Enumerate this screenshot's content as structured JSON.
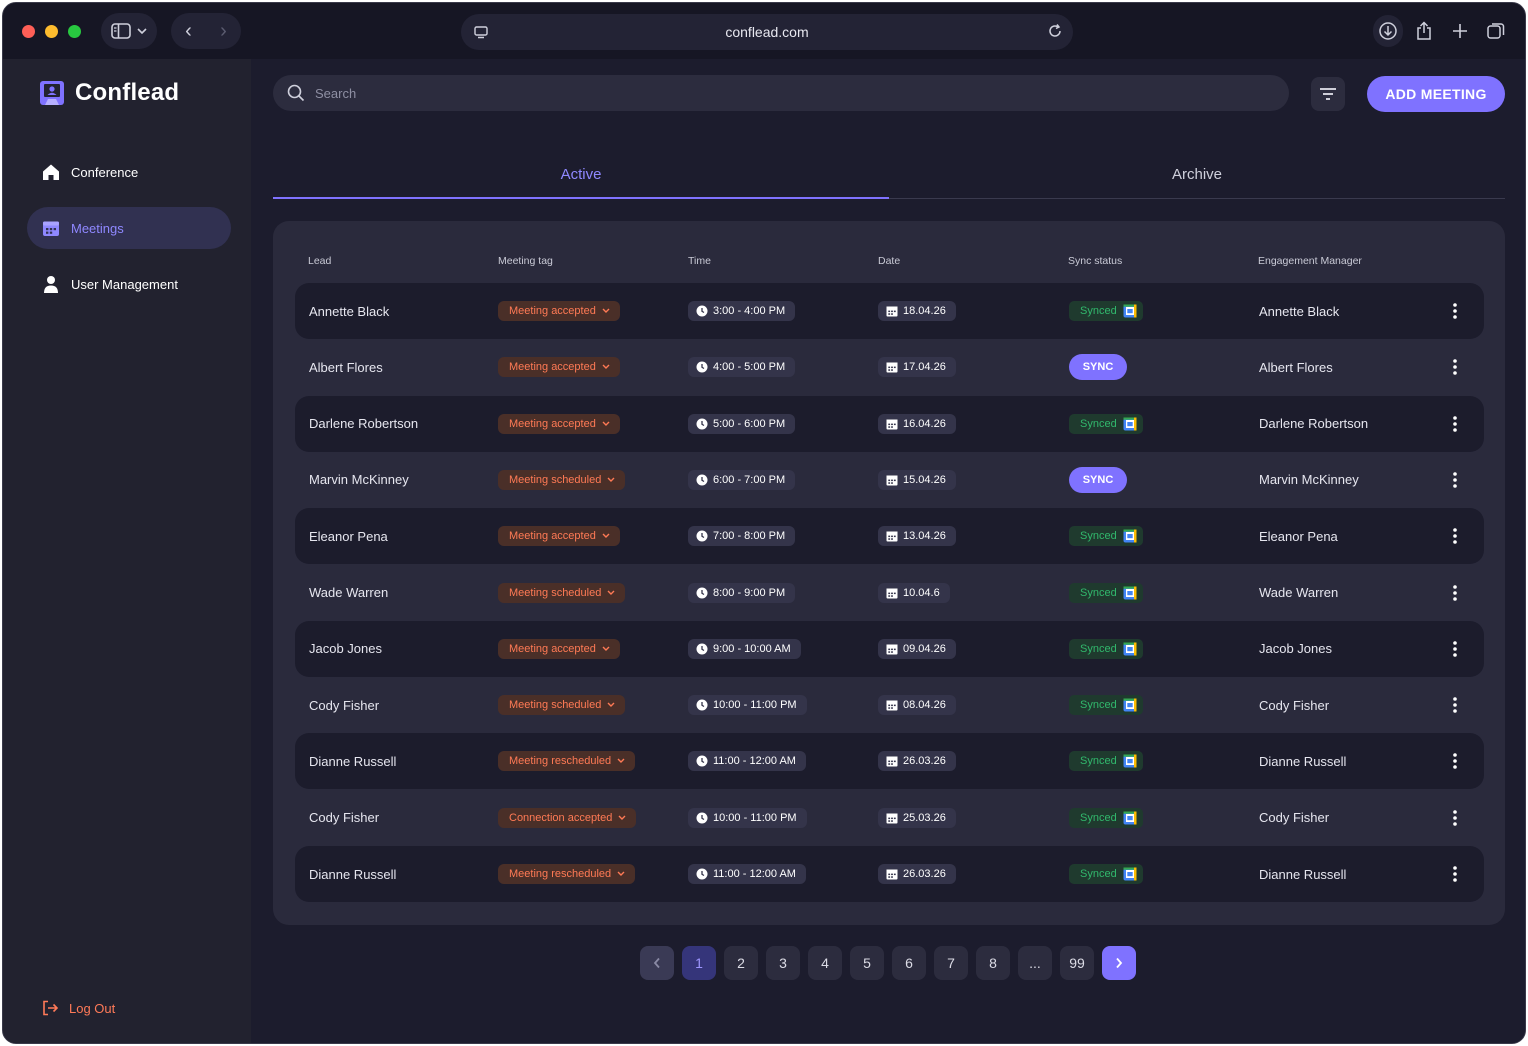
{
  "browser": {
    "url": "conflead.com"
  },
  "app": {
    "name": "Conflead"
  },
  "sidebar": {
    "items": [
      {
        "label": "Conference"
      },
      {
        "label": "Meetings"
      },
      {
        "label": "User Management"
      }
    ],
    "logout": "Log Out"
  },
  "toolbar": {
    "search_placeholder": "Search",
    "add_label": "ADD MEETING"
  },
  "tabs": [
    {
      "label": "Active"
    },
    {
      "label": "Archive"
    }
  ],
  "table": {
    "headers": [
      "Lead",
      "Meeting tag",
      "Time",
      "Date",
      "Sync status",
      "Engagement Manager"
    ],
    "rows": [
      {
        "lead": "Annette Black",
        "tag": "Meeting accepted",
        "time": "3:00 - 4:00 PM",
        "date": "18.04.26",
        "sync": "Synced",
        "em": "Annette Black"
      },
      {
        "lead": "Albert Flores",
        "tag": "Meeting accepted",
        "time": "4:00 - 5:00 PM",
        "date": "17.04.26",
        "sync": "SYNC",
        "em": "Albert Flores"
      },
      {
        "lead": "Darlene Robertson",
        "tag": "Meeting accepted",
        "time": "5:00 - 6:00 PM",
        "date": "16.04.26",
        "sync": "Synced",
        "em": "Darlene Robertson"
      },
      {
        "lead": "Marvin McKinney",
        "tag": "Meeting scheduled",
        "time": "6:00 - 7:00 PM",
        "date": "15.04.26",
        "sync": "SYNC",
        "em": "Marvin McKinney"
      },
      {
        "lead": "Eleanor Pena",
        "tag": "Meeting accepted",
        "time": "7:00 - 8:00 PM",
        "date": "13.04.26",
        "sync": "Synced",
        "em": "Eleanor Pena"
      },
      {
        "lead": "Wade Warren",
        "tag": "Meeting scheduled",
        "time": "8:00 - 9:00 PM",
        "date": "10.04.6",
        "sync": "Synced",
        "em": "Wade Warren"
      },
      {
        "lead": "Jacob Jones",
        "tag": "Meeting accepted",
        "time": "9:00 - 10:00 AM",
        "date": "09.04.26",
        "sync": "Synced",
        "em": "Jacob Jones"
      },
      {
        "lead": "Cody Fisher",
        "tag": "Meeting scheduled",
        "time": "10:00 - 11:00 PM",
        "date": "08.04.26",
        "sync": "Synced",
        "em": "Cody Fisher"
      },
      {
        "lead": "Dianne Russell",
        "tag": "Meeting rescheduled",
        "time": "11:00 - 12:00 AM",
        "date": "26.03.26",
        "sync": "Synced",
        "em": "Dianne Russell"
      },
      {
        "lead": "Cody Fisher",
        "tag": "Connection accepted",
        "time": "10:00 - 11:00 PM",
        "date": "25.03.26",
        "sync": "Synced",
        "em": "Cody Fisher"
      },
      {
        "lead": "Dianne Russell",
        "tag": "Meeting rescheduled",
        "time": "11:00 - 12:00 AM",
        "date": "26.03.26",
        "sync": "Synced",
        "em": "Dianne Russell"
      }
    ]
  },
  "pagination": {
    "pages": [
      "1",
      "2",
      "3",
      "4",
      "5",
      "6",
      "7",
      "8",
      "...",
      "99"
    ],
    "current": "1"
  },
  "colors": {
    "accent": "#7f72ff",
    "tag_text": "#ff7a55",
    "synced_text": "#31b86c",
    "background": "#1c1c2d"
  },
  "icons": {
    "nav": [
      "home-icon",
      "calendar-icon",
      "user-icon"
    ],
    "row": [
      "clock-icon",
      "calendar-icon",
      "google-calendar-icon",
      "more-vertical-icon"
    ]
  }
}
